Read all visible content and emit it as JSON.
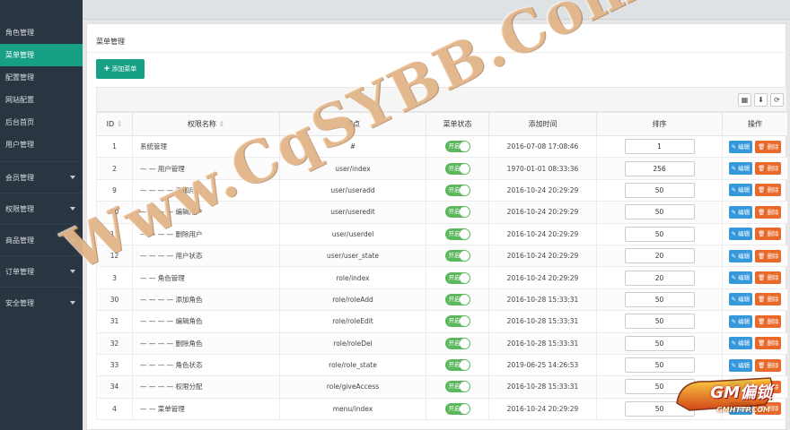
{
  "topbar": {
    "breadcrumb": ""
  },
  "sidebar": {
    "items": [
      {
        "label": "角色管理",
        "active": false
      },
      {
        "label": "菜单管理",
        "active": true
      },
      {
        "label": "配置管理",
        "active": false
      },
      {
        "label": "网站配置",
        "active": false
      },
      {
        "label": "后台首页",
        "active": false
      },
      {
        "label": "用户管理",
        "active": false
      }
    ],
    "groups": [
      {
        "label": "会员管理"
      },
      {
        "label": "权限管理"
      },
      {
        "label": "商品管理"
      },
      {
        "label": "订单管理"
      },
      {
        "label": "安全管理"
      }
    ]
  },
  "panel": {
    "title": "菜单管理",
    "add_button": "添加菜单"
  },
  "toolbar": {
    "icons": [
      "grid-icon",
      "export-icon",
      "refresh-icon"
    ]
  },
  "table": {
    "headers": {
      "id": "ID",
      "name": "权限名称",
      "node": "节点",
      "status": "菜单状态",
      "time": "添加时间",
      "sort": "排序",
      "action": "操作"
    },
    "switch_label": "开启",
    "edit_label": "编辑",
    "delete_label": "删除",
    "rows": [
      {
        "id": "1",
        "name": "系统管理",
        "node": "#",
        "time": "2016-07-08 17:08:46",
        "sort": "1"
      },
      {
        "id": "2",
        "name": "— — 用户管理",
        "node": "user/index",
        "time": "1970-01-01 08:33:36",
        "sort": "256"
      },
      {
        "id": "9",
        "name": "— — — — 添加用户",
        "node": "user/useradd",
        "time": "2016-10-24 20:29:29",
        "sort": "50"
      },
      {
        "id": "10",
        "name": "— — — — 编辑用户",
        "node": "user/useredit",
        "time": "2016-10-24 20:29:29",
        "sort": "50"
      },
      {
        "id": "11",
        "name": "— — — — 删除用户",
        "node": "user/userdel",
        "time": "2016-10-24 20:29:29",
        "sort": "50"
      },
      {
        "id": "12",
        "name": "— — — — 用户状态",
        "node": "user/user_state",
        "time": "2016-10-24 20:29:29",
        "sort": "20"
      },
      {
        "id": "3",
        "name": "— — 角色管理",
        "node": "role/index",
        "time": "2016-10-24 20:29:29",
        "sort": "20"
      },
      {
        "id": "30",
        "name": "— — — — 添加角色",
        "node": "role/roleAdd",
        "time": "2016-10-28 15:33:31",
        "sort": "50"
      },
      {
        "id": "31",
        "name": "— — — — 编辑角色",
        "node": "role/roleEdit",
        "time": "2016-10-28 15:33:31",
        "sort": "50"
      },
      {
        "id": "32",
        "name": "— — — — 删除角色",
        "node": "role/roleDel",
        "time": "2016-10-28 15:33:31",
        "sort": "50"
      },
      {
        "id": "33",
        "name": "— — — — 角色状态",
        "node": "role/role_state",
        "time": "2019-06-25 14:26:53",
        "sort": "50"
      },
      {
        "id": "34",
        "name": "— — — — 权限分配",
        "node": "role/giveAccess",
        "time": "2016-10-28 15:33:31",
        "sort": "50"
      },
      {
        "id": "4",
        "name": "— — 菜单管理",
        "node": "menu/index",
        "time": "2016-10-24 20:29:29",
        "sort": "50"
      }
    ]
  },
  "watermark": {
    "text": "Www.CqSYBB.Com",
    "logo": "GM偏锁",
    "logo_sub": "GMHTTP.COM"
  },
  "colors": {
    "accent": "#16a085",
    "sidebar_bg": "#2a3542",
    "switch_on": "#5cb85c",
    "edit": "#3498db",
    "delete": "#e8692a"
  }
}
